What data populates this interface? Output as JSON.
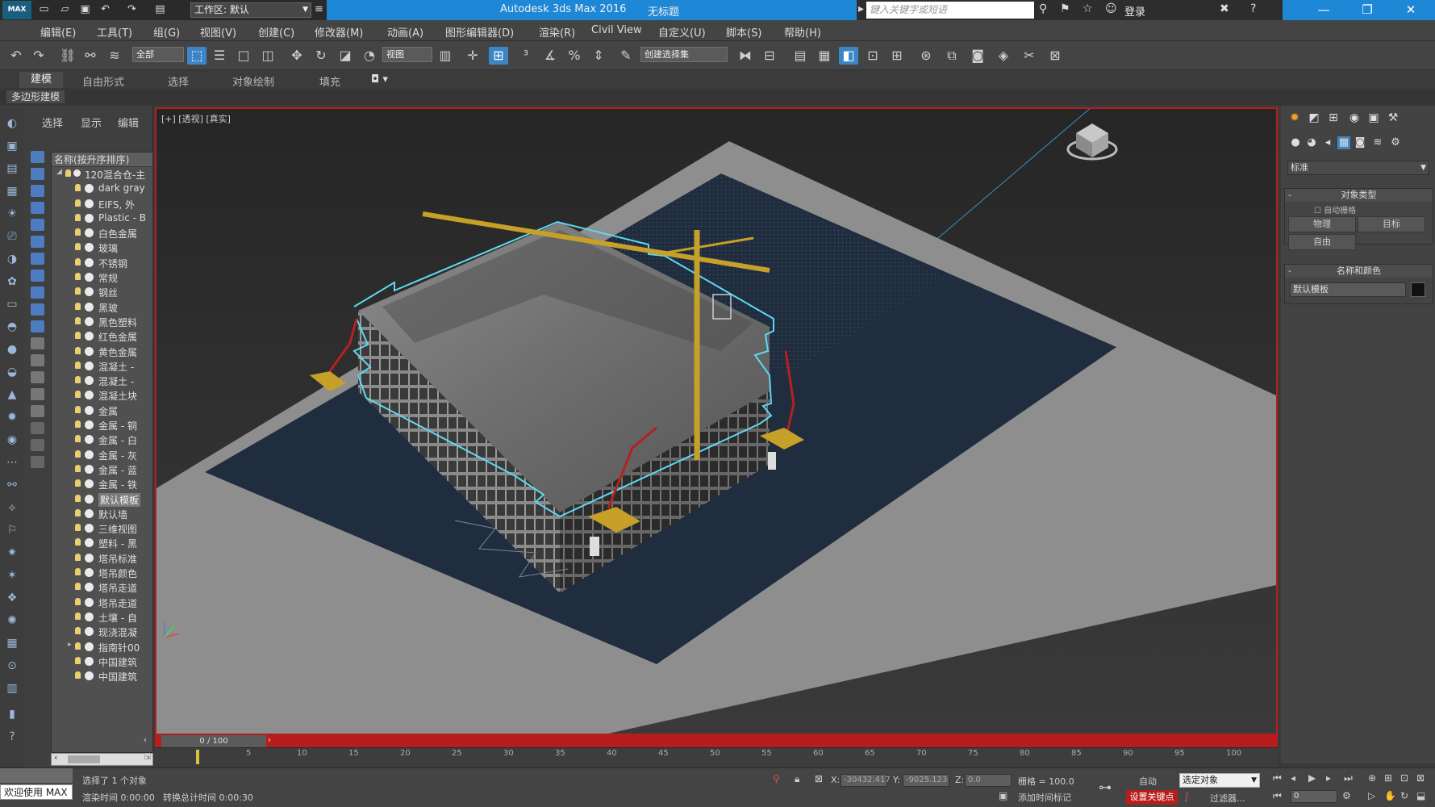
{
  "titlebar": {
    "logo": "MAX",
    "workspace_label": "工作区: 默认",
    "title": "Autodesk 3ds Max 2016",
    "subtitle": "无标题",
    "search_placeholder": "键入关键字或短语",
    "login": "登录"
  },
  "menu": [
    "编辑(E)",
    "工具(T)",
    "组(G)",
    "视图(V)",
    "创建(C)",
    "修改器(M)",
    "动画(A)",
    "图形编辑器(D)",
    "渲染(R)",
    "Civil View",
    "自定义(U)",
    "脚本(S)",
    "帮助(H)"
  ],
  "toolbar": {
    "filter_select": "全部",
    "view_select": "视图",
    "named_sel_select": "创建选择集"
  },
  "ribbon": {
    "tabs": [
      "建模",
      "自由形式",
      "选择",
      "对象绘制",
      "填充"
    ],
    "sub_label": "多边形建模"
  },
  "scene_explorer": {
    "tabs": [
      "选择",
      "显示",
      "编辑"
    ],
    "header": "名称(按升序排序)",
    "root": "120混合仓-主",
    "items": [
      "dark gray",
      "EIFS, 外",
      "Plastic - B",
      "白色金属",
      "玻璃",
      "不锈钢",
      "常规",
      "钢丝",
      "黑玻",
      "黑色塑料",
      "红色金属",
      "黄色金属",
      "混凝土 -",
      "混凝土 -",
      "混凝土块",
      "金属",
      "金属 - 铜",
      "金属 - 白",
      "金属 - 灰",
      "金属 - 蓝",
      "金属 - 铁",
      "默认模板",
      "默认墙",
      "三维视图",
      "塑料 - 黑",
      "塔吊标准",
      "塔吊颜色",
      "塔吊走道",
      "塔吊走道",
      "土壤 - 自",
      "现浇混凝",
      "指南针00",
      "中国建筑",
      "中国建筑"
    ],
    "selected_item": "默认模板"
  },
  "viewport": {
    "label": "[+] [透视] [真实]"
  },
  "timeline": {
    "frame_display": "0 / 100",
    "ticks": [
      "5",
      "10",
      "15",
      "20",
      "25",
      "30",
      "35",
      "40",
      "45",
      "50",
      "55",
      "60",
      "65",
      "70",
      "75",
      "80",
      "85",
      "90",
      "95",
      "100"
    ]
  },
  "command_panel": {
    "dropdown": "标准",
    "rollout_object_type": "对象类型",
    "auto_grid": "自动栅格",
    "buttons": [
      "物理",
      "目标",
      "自由"
    ],
    "rollout_name_color": "名称和颜色",
    "name_field": "默认模板"
  },
  "statusbar": {
    "welcome": "欢迎使用 MAX",
    "selected_msg": "选择了 1 个对象",
    "render_time": "渲染时间 0:00:00",
    "convert_time": "转换总计时间 0:00:30",
    "x_value": "-30432.417",
    "y_value": "-9025.123",
    "z_value": "0.0",
    "grid": "栅格 = 100.0",
    "auto_label": "自动",
    "selected_object": "选定对象",
    "set_key": "设置关键点",
    "key_filters": "过滤器...",
    "add_time_tag": "添加时间标记",
    "frame_field": "0"
  }
}
